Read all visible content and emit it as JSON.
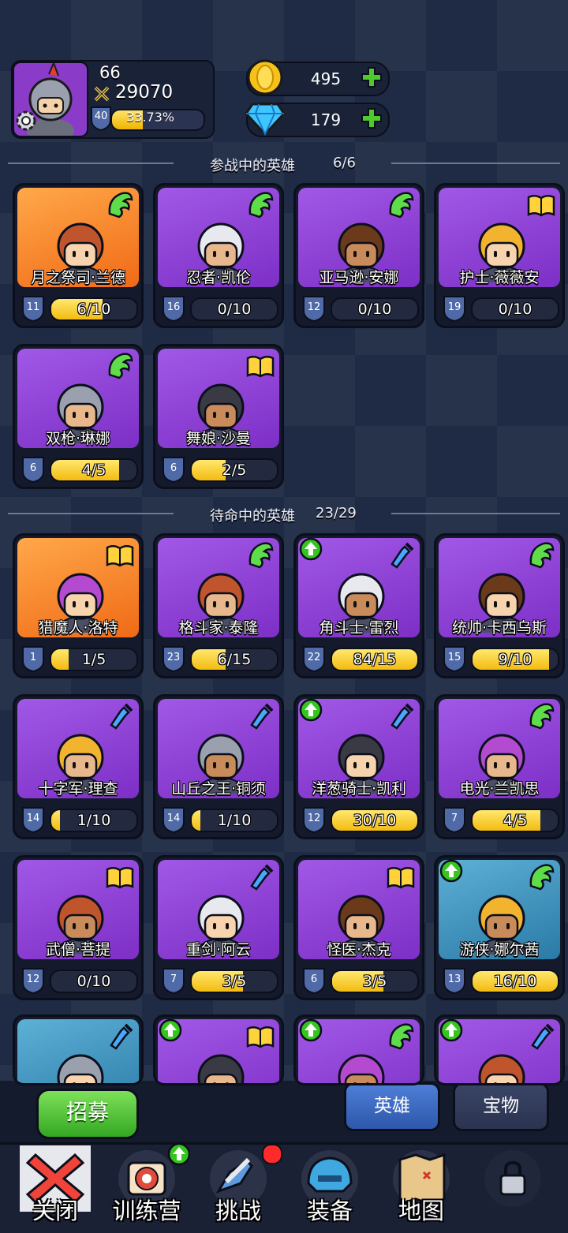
{
  "player": {
    "level": "66",
    "power": "29070",
    "xp_level": "40",
    "xp_percent": "33.73%",
    "xp_fraction": 0.3373
  },
  "currency": {
    "gold": "495",
    "gems": "179"
  },
  "active_section": {
    "title": "参战中的英雄",
    "count": "6/6"
  },
  "standby_section": {
    "title": "待命中的英雄",
    "count": "23/29"
  },
  "active_heroes": [
    {
      "name": "月之祭司·兰德",
      "level": "11",
      "progress": "6/10",
      "fill": 0.6,
      "bg": "orange",
      "type": "wing",
      "upgrade": false
    },
    {
      "name": "忍者·凯伦",
      "level": "16",
      "progress": "0/10",
      "fill": 0,
      "bg": "purple",
      "type": "wing",
      "upgrade": false
    },
    {
      "name": "亚马逊·安娜",
      "level": "12",
      "progress": "0/10",
      "fill": 0,
      "bg": "purple",
      "type": "wing",
      "upgrade": false
    },
    {
      "name": "护士·薇薇安",
      "level": "19",
      "progress": "0/10",
      "fill": 0,
      "bg": "purple",
      "type": "book",
      "upgrade": false
    },
    {
      "name": "双枪·琳娜",
      "level": "6",
      "progress": "4/5",
      "fill": 0.8,
      "bg": "purple",
      "type": "wing",
      "upgrade": false
    },
    {
      "name": "舞娘·沙曼",
      "level": "6",
      "progress": "2/5",
      "fill": 0.4,
      "bg": "purple",
      "type": "book",
      "upgrade": false
    }
  ],
  "standby_heroes": [
    {
      "name": "猎魔人·洛特",
      "level": "1",
      "progress": "1/5",
      "fill": 0.2,
      "bg": "orange",
      "type": "book",
      "upgrade": false
    },
    {
      "name": "格斗家·泰隆",
      "level": "23",
      "progress": "6/15",
      "fill": 0.4,
      "bg": "purple",
      "type": "wing",
      "upgrade": false
    },
    {
      "name": "角斗士·雷烈",
      "level": "22",
      "progress": "84/15",
      "fill": 1,
      "bg": "purple",
      "type": "potion",
      "upgrade": true
    },
    {
      "name": "统帅·卡西乌斯",
      "level": "15",
      "progress": "9/10",
      "fill": 0.9,
      "bg": "purple",
      "type": "wing",
      "upgrade": false
    },
    {
      "name": "十字军·理查",
      "level": "14",
      "progress": "1/10",
      "fill": 0.1,
      "bg": "purple",
      "type": "potion",
      "upgrade": false
    },
    {
      "name": "山丘之王·铜须",
      "level": "14",
      "progress": "1/10",
      "fill": 0.1,
      "bg": "purple",
      "type": "potion",
      "upgrade": false
    },
    {
      "name": "洋葱骑士·凯利",
      "level": "12",
      "progress": "30/10",
      "fill": 1,
      "bg": "purple",
      "type": "potion",
      "upgrade": true
    },
    {
      "name": "电光·兰凯思",
      "level": "7",
      "progress": "4/5",
      "fill": 0.8,
      "bg": "purple",
      "type": "wing",
      "upgrade": false
    },
    {
      "name": "武僧·菩提",
      "level": "12",
      "progress": "0/10",
      "fill": 0,
      "bg": "purple",
      "type": "book",
      "upgrade": false
    },
    {
      "name": "重剑·阿云",
      "level": "7",
      "progress": "3/5",
      "fill": 0.6,
      "bg": "purple",
      "type": "potion",
      "upgrade": false
    },
    {
      "name": "怪医·杰克",
      "level": "6",
      "progress": "3/5",
      "fill": 0.6,
      "bg": "purple",
      "type": "book",
      "upgrade": false
    },
    {
      "name": "游侠·娜尔茜",
      "level": "13",
      "progress": "16/10",
      "fill": 1,
      "bg": "teal",
      "type": "wing",
      "upgrade": true
    }
  ],
  "partial_heroes": [
    {
      "bg": "teal",
      "type": "potion",
      "upgrade": false
    },
    {
      "bg": "purple",
      "type": "book",
      "upgrade": true
    },
    {
      "bg": "purple",
      "type": "wing",
      "upgrade": true
    },
    {
      "bg": "purple",
      "type": "potion",
      "upgrade": true
    }
  ],
  "buttons": {
    "recruit": "招募",
    "tab_heroes": "英雄",
    "tab_treasure": "宝物"
  },
  "nav": [
    {
      "label": "关闭",
      "icon": "close-icon"
    },
    {
      "label": "训练营",
      "icon": "target-icon",
      "badge": "upgrade"
    },
    {
      "label": "挑战",
      "icon": "sword-icon",
      "badge": "notification"
    },
    {
      "label": "装备",
      "icon": "helmet-icon"
    },
    {
      "label": "地图",
      "icon": "map-icon"
    },
    {
      "label": "",
      "icon": "lock-icon"
    }
  ],
  "colors": {
    "accent_gold": "#f3bb10",
    "purple": "#8b40d6",
    "green": "#4ccb2a"
  }
}
